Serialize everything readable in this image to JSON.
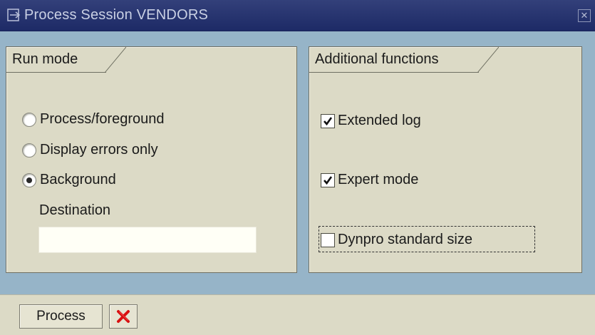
{
  "window": {
    "title": "Process Session VENDORS",
    "title_icon": "dialog-arrow-icon",
    "close_icon": "close-icon"
  },
  "run_mode": {
    "group_label": "Run mode",
    "options": [
      {
        "label": "Process/foreground",
        "selected": false
      },
      {
        "label": "Display errors only",
        "selected": false
      },
      {
        "label": "Background",
        "selected": true
      }
    ],
    "destination_label": "Destination",
    "destination_value": ""
  },
  "additional_functions": {
    "group_label": "Additional functions",
    "options": [
      {
        "label": "Extended log",
        "checked": true
      },
      {
        "label": "Expert mode",
        "checked": true
      },
      {
        "label": "Dynpro standard size",
        "checked": false
      }
    ]
  },
  "footer": {
    "process_label": "Process",
    "cancel_icon": "cancel-x-icon",
    "cancel_color": "#d81010"
  },
  "colors": {
    "titlebar": "#1d2a66",
    "background": "#96b4c8",
    "panel": "#dcdac6"
  }
}
